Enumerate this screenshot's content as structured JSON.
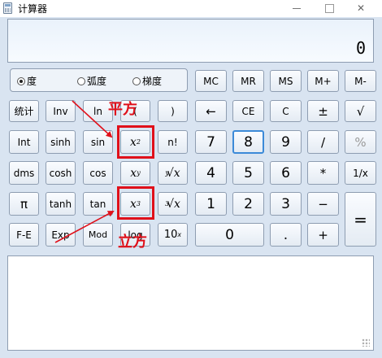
{
  "window": {
    "title": "计算器"
  },
  "display": {
    "value": "0"
  },
  "angle_modes": [
    {
      "label": "度",
      "checked": true
    },
    {
      "label": "弧度",
      "checked": false
    },
    {
      "label": "梯度",
      "checked": false
    }
  ],
  "memory": {
    "mc": "MC",
    "mr": "MR",
    "ms": "MS",
    "mplus": "M+",
    "mminus": "M-"
  },
  "sci": {
    "stats": "统计",
    "inv": "Inv",
    "ln": "ln",
    "paren_open": "(",
    "paren_close": ")",
    "int": "Int",
    "sinh": "sinh",
    "sin": "sin",
    "square_base": "x",
    "square_exp": "2",
    "factorial": "n!",
    "dms": "dms",
    "cosh": "cosh",
    "cos": "cos",
    "power_base": "x",
    "power_exp": "y",
    "yroot_index": "y",
    "yroot_sym": "√",
    "yroot_var": "x",
    "pi": "π",
    "tanh": "tanh",
    "tan": "tan",
    "cube_base": "x",
    "cube_exp": "3",
    "cuberoot_index": "3",
    "cuberoot_sym": "√",
    "cuberoot_var": "x",
    "fe": "F-E",
    "exp": "Exp",
    "mod": "Mod",
    "log": "log",
    "tenpow_base": "10",
    "tenpow_exp": "x"
  },
  "keys": {
    "backspace": "←",
    "ce": "CE",
    "c": "C",
    "plusminus": "±",
    "sqrt": "√",
    "d7": "7",
    "d8": "8",
    "d9": "9",
    "divide": "/",
    "percent": "%",
    "d4": "4",
    "d5": "5",
    "d6": "6",
    "multiply": "*",
    "reciprocal": "1/x",
    "d1": "1",
    "d2": "2",
    "d3": "3",
    "minus": "−",
    "equals": "=",
    "d0": "0",
    "dot": ".",
    "plus": "+"
  },
  "annotations": {
    "square": "平方",
    "cube": "立方"
  },
  "colors": {
    "highlight": "#e0101a",
    "focus_border": "#3c8ad8",
    "background": "#d9e4f1"
  }
}
